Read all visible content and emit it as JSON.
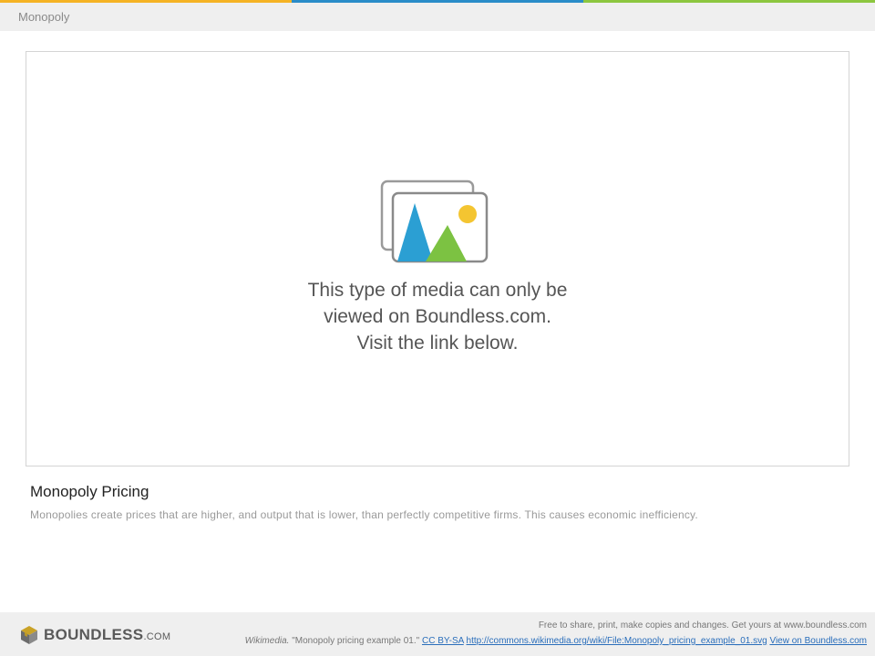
{
  "colors": {
    "top_bar": [
      "#f5b324",
      "#2a8cc8",
      "#8cc63f"
    ],
    "placeholder_blue": "#2b9fd3",
    "placeholder_green": "#7cc242",
    "placeholder_sun": "#f4c531"
  },
  "header": {
    "title": "Monopoly"
  },
  "media": {
    "icon": "image-placeholder-icon",
    "line1": "This type of media can only be",
    "line2": "viewed on Boundless.com.",
    "line3": "Visit the link below."
  },
  "caption": {
    "title": "Monopoly Pricing",
    "text": "Monopolies create prices that are higher, and output that is lower, than perfectly competitive firms. This causes economic inefficiency."
  },
  "footer": {
    "logo_name": "BOUNDLESS",
    "logo_suffix": ".COM",
    "free_text": "Free to share, print, make copies and changes. Get yours at www.boundless.com",
    "credit_source": "Wikimedia.",
    "credit_title": " \"Monopoly pricing example 01.\" ",
    "license_link": "CC BY-SA",
    "wiki_link": "http://commons.wikimedia.org/wiki/File:Monopoly_pricing_example_01.svg",
    "boundless_link": "View on Boundless.com"
  }
}
